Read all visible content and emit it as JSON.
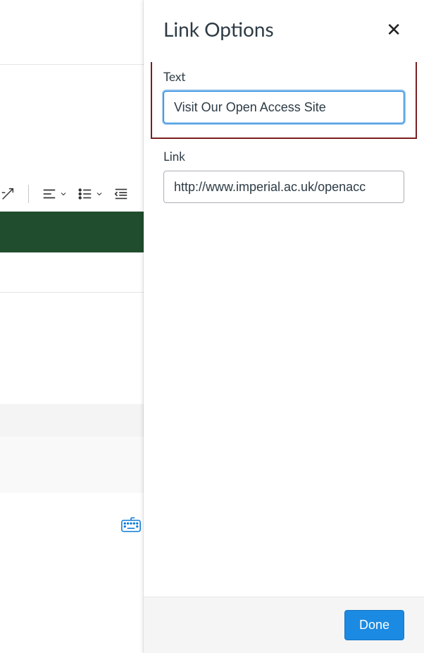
{
  "panel": {
    "title": "Link Options",
    "text_label": "Text",
    "text_value": "Visit Our Open Access Site",
    "link_label": "Link",
    "link_value": "http://www.imperial.ac.uk/openacc",
    "done_label": "Done"
  }
}
